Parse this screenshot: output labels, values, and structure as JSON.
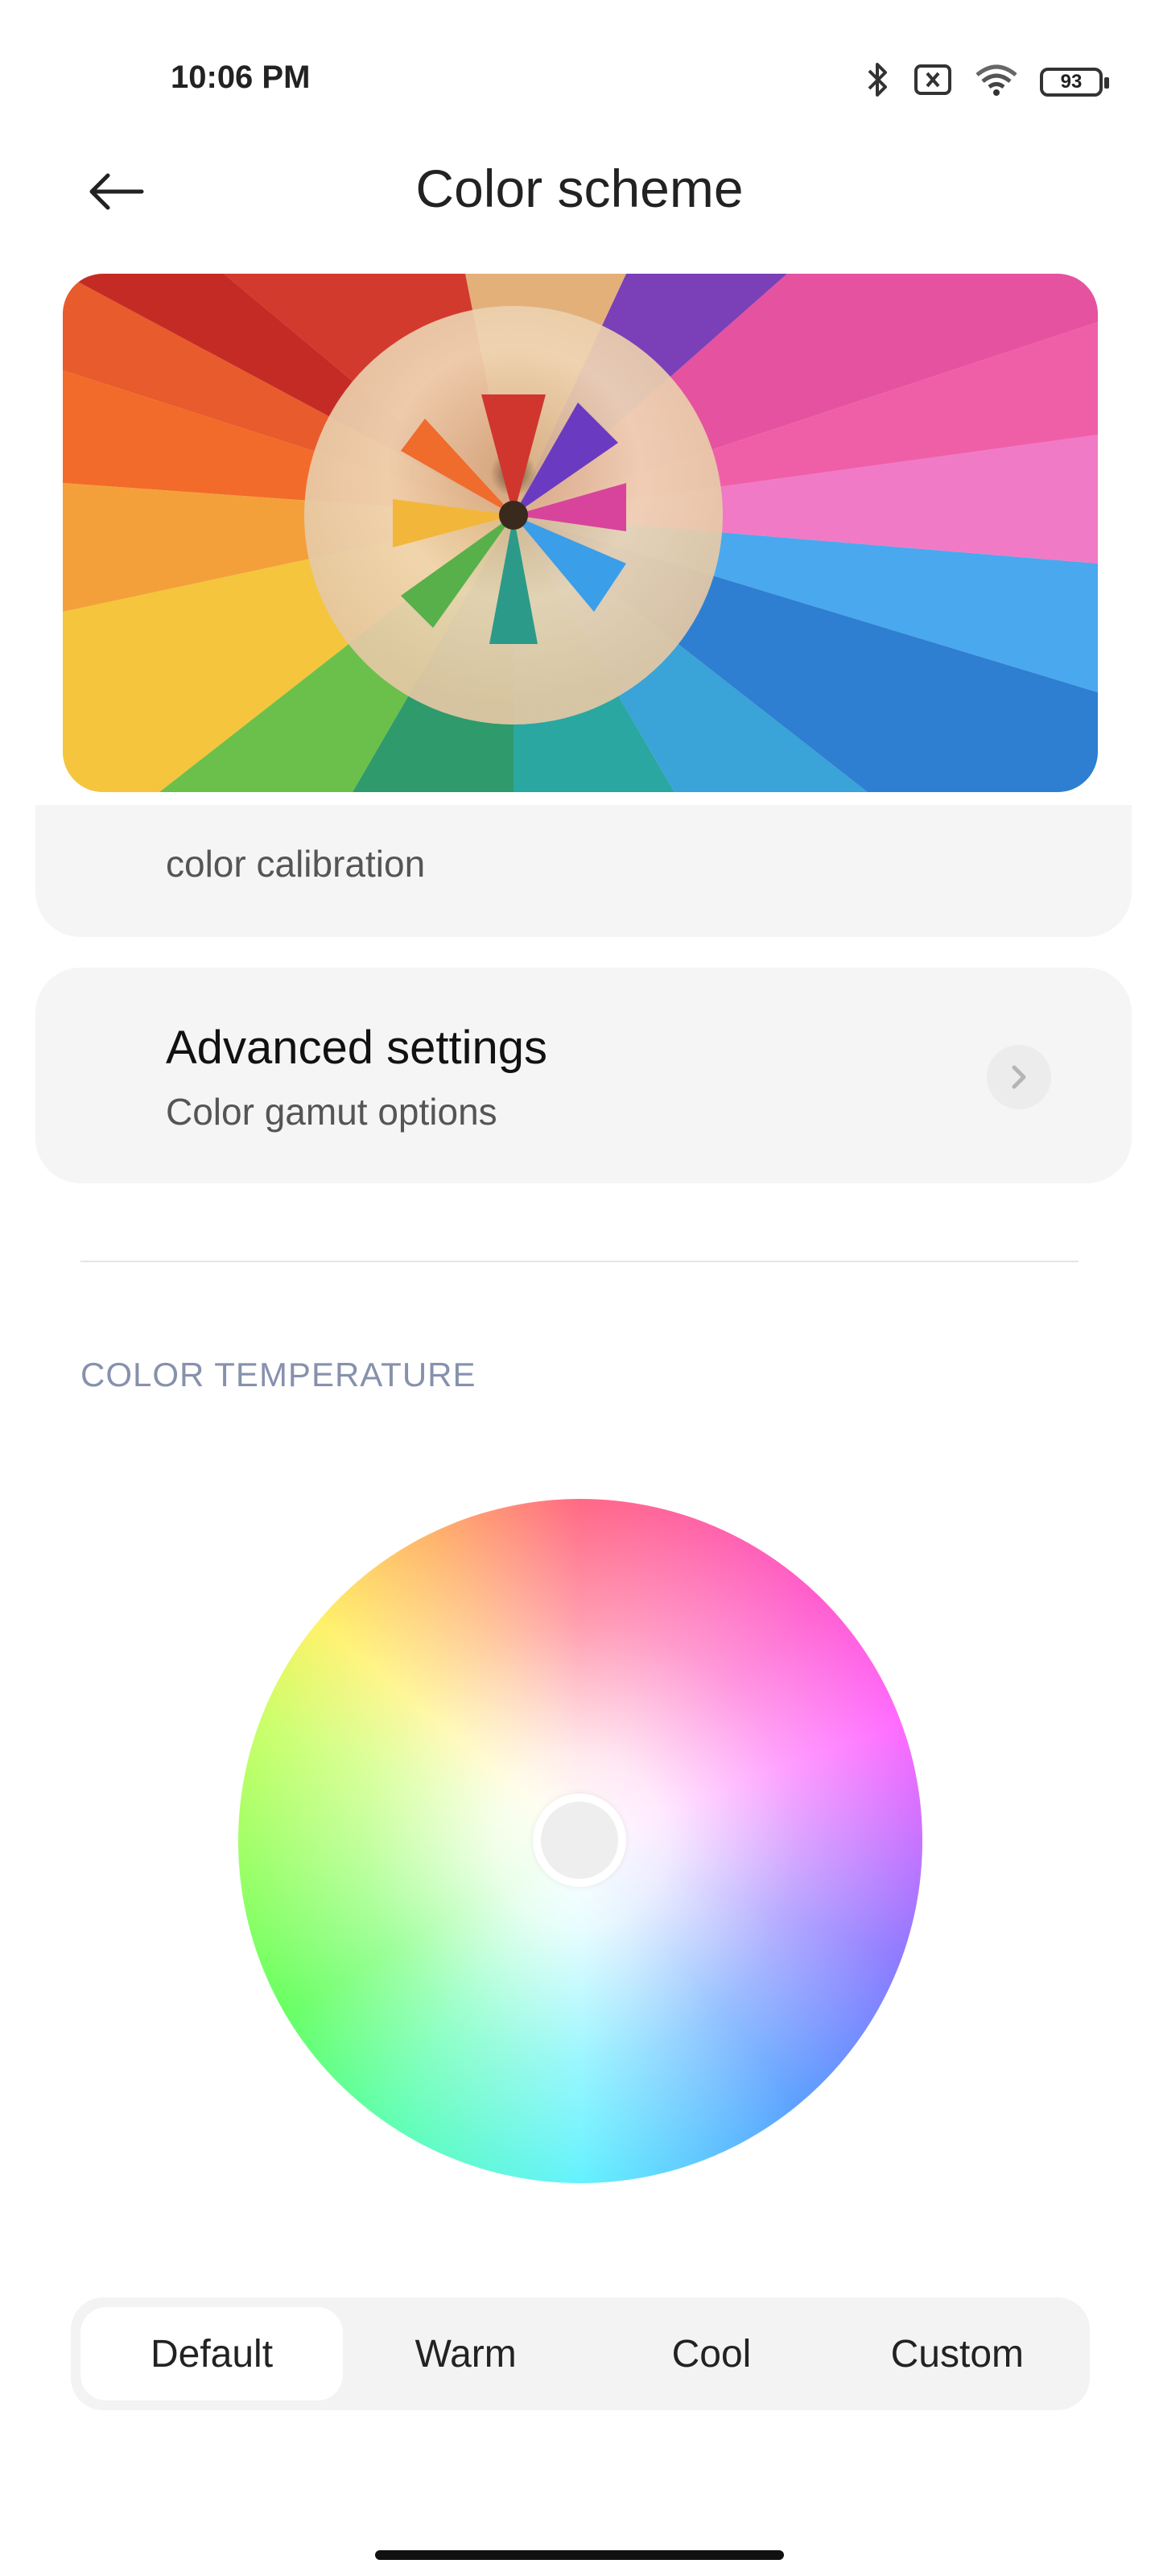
{
  "status_bar": {
    "time": "10:06 PM",
    "battery_level": "93",
    "icons": [
      "bluetooth-icon",
      "sim-off-icon",
      "wifi-icon",
      "battery-icon"
    ]
  },
  "header": {
    "title": "Color scheme",
    "back_icon": "arrow-left-icon"
  },
  "cards": {
    "calibration_text": "color calibration",
    "advanced": {
      "title": "Advanced settings",
      "subtitle": "Color gamut options",
      "icon": "chevron-right-icon"
    }
  },
  "color_temperature": {
    "section_title": "COLOR TEMPERATURE",
    "modes": [
      "Default",
      "Warm",
      "Cool",
      "Custom"
    ],
    "selected_mode": "Default"
  },
  "colors": {
    "background": "#ffffff",
    "card": "#f5f5f5",
    "section_title": "#8791ad",
    "segment_bg": "#f3f3f3",
    "segment_active": "#ffffff"
  }
}
